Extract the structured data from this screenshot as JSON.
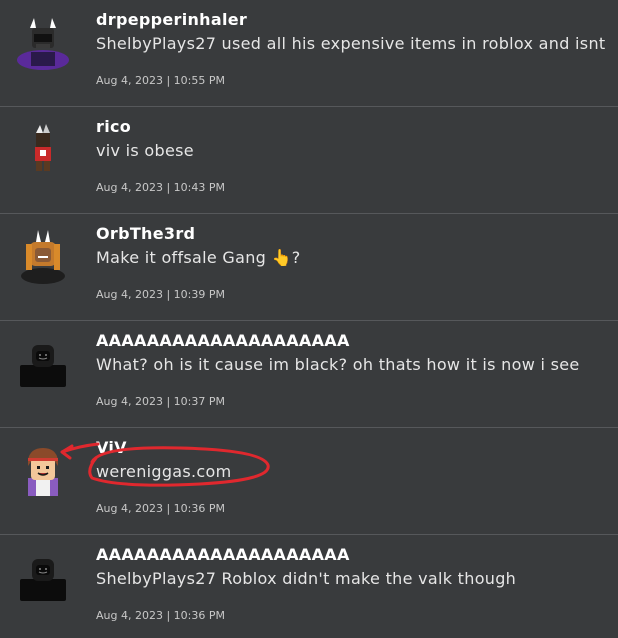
{
  "comments": [
    {
      "username": "drpepperinhaler",
      "text": "ShelbyPlays27 used all his expensive items in roblox and isnt",
      "timestamp": "Aug 4, 2023 | 10:55 PM",
      "avatar_icon": "purple-caped-avatar"
    },
    {
      "username": "rico",
      "text": "viv is obese",
      "timestamp": "Aug 4, 2023 | 10:43 PM",
      "avatar_icon": "red-shirt-avatar"
    },
    {
      "username": "OrbThe3rd",
      "text": "Make it offsale Gang 👆?",
      "timestamp": "Aug 4, 2023 | 10:39 PM",
      "avatar_icon": "dreadlock-avatar"
    },
    {
      "username": "AAAAAAAAAAAAAAAAAAAA",
      "text": "What? oh is it cause im black? oh thats how it is now i see",
      "timestamp": "Aug 4, 2023 | 10:37 PM",
      "avatar_icon": "black-hooded-avatar"
    },
    {
      "username": "ViV",
      "text": "wereniggas.com",
      "timestamp": "Aug 4, 2023 | 10:36 PM",
      "avatar_icon": "brown-hair-avatar"
    },
    {
      "username": "AAAAAAAAAAAAAAAAAAAA",
      "text": "ShelbyPlays27 Roblox didn't make the valk though",
      "timestamp": "Aug 4, 2023 | 10:36 PM",
      "avatar_icon": "black-hooded-avatar"
    }
  ],
  "colors": {
    "background": "#393b3d",
    "divider": "#56585b",
    "annotation_red": "#e0282e"
  }
}
